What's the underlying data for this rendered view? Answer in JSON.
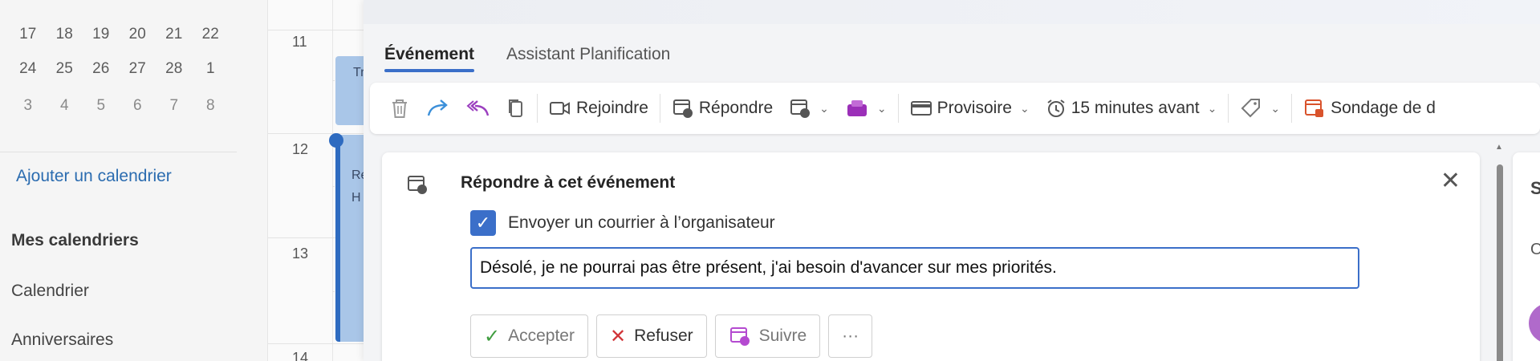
{
  "sidebar": {
    "mini_rows": [
      [
        "17",
        "18",
        "19",
        "20",
        "21",
        "22"
      ],
      [
        "24",
        "25",
        "26",
        "27",
        "28",
        "1"
      ],
      [
        "3",
        "4",
        "5",
        "6",
        "7",
        "8"
      ]
    ],
    "add_calendar": "Ajouter un calendrier",
    "my_calendars": "Mes calendriers",
    "calendars": [
      "Calendrier",
      "Anniversaires"
    ]
  },
  "day": {
    "hours": [
      "11",
      "12",
      "13",
      "14"
    ],
    "event_a_text": "Tr",
    "event_b_text": "Re\nH"
  },
  "tabs": [
    "Événement",
    "Assistant Planification"
  ],
  "toolbar": {
    "join": "Rejoindre",
    "respond": "Répondre",
    "status": "Provisoire",
    "reminder": "15 minutes avant",
    "poll": "Sondage de d"
  },
  "respond_card": {
    "title": "Répondre à cet événement",
    "send_checkbox_label": "Envoyer un courrier à l’organisateur",
    "message_value": "Désolé, je ne pourrai pas être présent, j'ai besoin d'avancer sur mes priorités.",
    "accept": "Accepter",
    "decline": "Refuser",
    "follow": "Suivre",
    "more": "···"
  },
  "right_card": {
    "s": "S",
    "o": "O"
  },
  "colors": {
    "accent": "#3b6fc9",
    "event": "#a9c6e8",
    "avatar": "#b06acb",
    "decline_icon": "#d13438",
    "accept_icon": "#107c10"
  }
}
